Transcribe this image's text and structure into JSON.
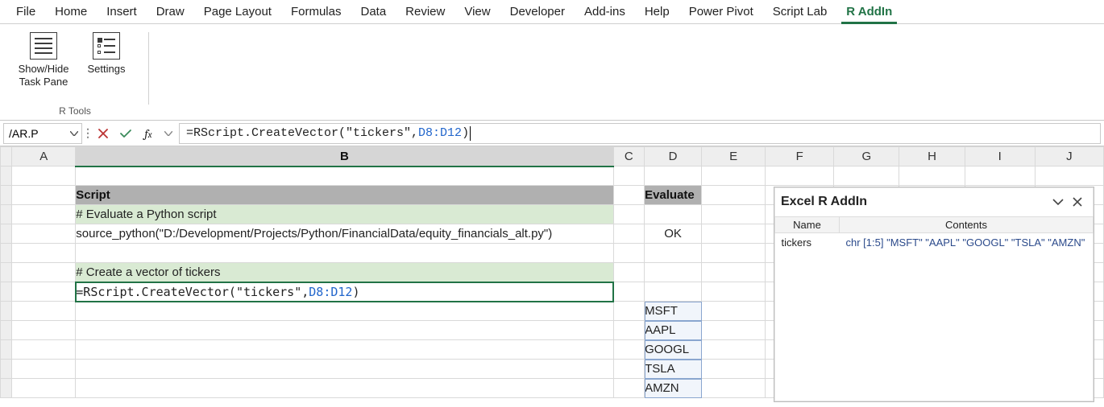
{
  "ribbon": {
    "tabs": [
      "File",
      "Home",
      "Insert",
      "Draw",
      "Page Layout",
      "Formulas",
      "Data",
      "Review",
      "View",
      "Developer",
      "Add-ins",
      "Help",
      "Power Pivot",
      "Script Lab",
      "R AddIn"
    ],
    "active_tab": "R AddIn",
    "group_title": "R Tools",
    "show_hide_label_1": "Show/Hide",
    "show_hide_label_2": "Task Pane",
    "settings_label": "Settings"
  },
  "formula_bar": {
    "name_box": "/AR.P",
    "formula_prefix": "=RScript.CreateVector(\"tickers\",",
    "formula_ref": "D8:D12",
    "formula_suffix": ")"
  },
  "columns": [
    "A",
    "B",
    "C",
    "D",
    "E",
    "F",
    "G",
    "H",
    "I",
    "J"
  ],
  "rows_visible": 12,
  "sheet": {
    "B2": "Script",
    "D2": "Evaluate",
    "B3": "# Evaluate a Python script",
    "B4": "source_python(\"D:/Development/Projects/Python/FinancialData/equity_financials_alt.py\")",
    "D4": "OK",
    "B6": "# Create a vector of tickers",
    "B7_prefix": "=RScript.CreateVector(\"tickers\",",
    "B7_ref": "D8:D12",
    "B7_suffix": ")",
    "D8": "MSFT",
    "D9": "AAPL",
    "D10": "GOOGL",
    "D11": "TSLA",
    "D12": "AMZN"
  },
  "pane": {
    "title": "Excel R AddIn",
    "col_name": "Name",
    "col_contents": "Contents",
    "rows": [
      {
        "name": "tickers",
        "contents": "chr [1:5] \"MSFT\" \"AAPL\" \"GOOGL\" \"TSLA\" \"AMZN\""
      }
    ]
  }
}
